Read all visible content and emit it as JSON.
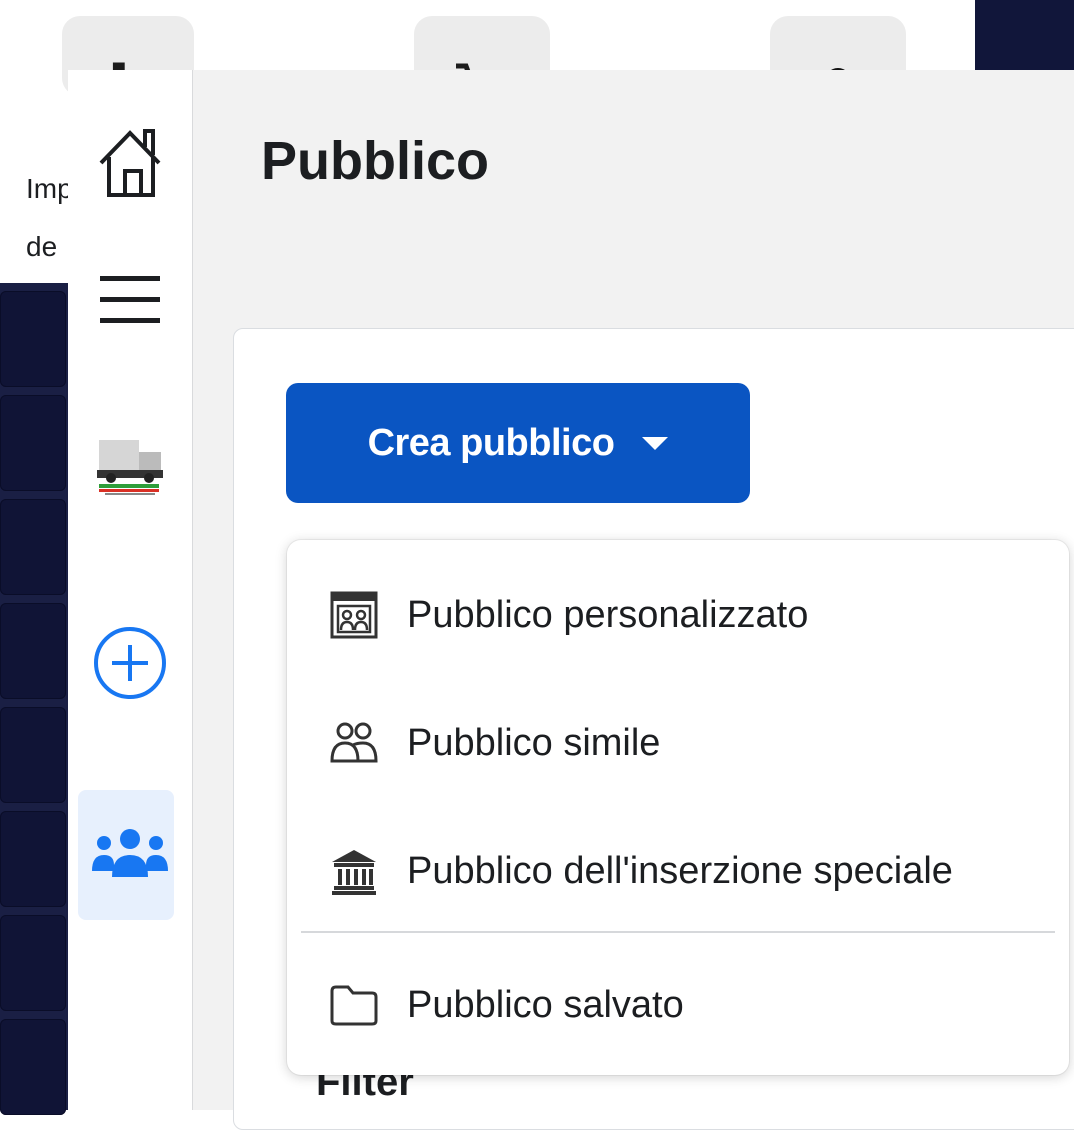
{
  "background": {
    "partial_text": [
      "Imp",
      "de"
    ]
  },
  "nav": {
    "items": [
      {
        "name": "home",
        "icon": "home-icon"
      },
      {
        "name": "menu",
        "icon": "hamburger-menu-icon"
      },
      {
        "name": "account",
        "icon": "account-logo"
      },
      {
        "name": "create",
        "icon": "plus-circle-icon"
      },
      {
        "name": "audiences",
        "icon": "people-group-icon",
        "active": true
      }
    ]
  },
  "page": {
    "title": "Pubblico"
  },
  "toolbar": {
    "create_label": "Crea pubblico"
  },
  "dropdown": {
    "items": [
      {
        "label": "Pubblico personalizzato",
        "icon": "custom-audience-icon"
      },
      {
        "label": "Pubblico simile",
        "icon": "lookalike-people-icon"
      },
      {
        "label": "Pubblico dell'inserzione speciale",
        "icon": "institution-building-icon"
      },
      {
        "label": "Pubblico salvato",
        "icon": "folder-icon"
      }
    ]
  },
  "filter": {
    "label": "Filter"
  },
  "colors": {
    "primary_button": "#0a55c2",
    "active_nav_bg": "#e7f0fd",
    "accent_icon": "#1877f2",
    "text": "#1c1e21"
  }
}
